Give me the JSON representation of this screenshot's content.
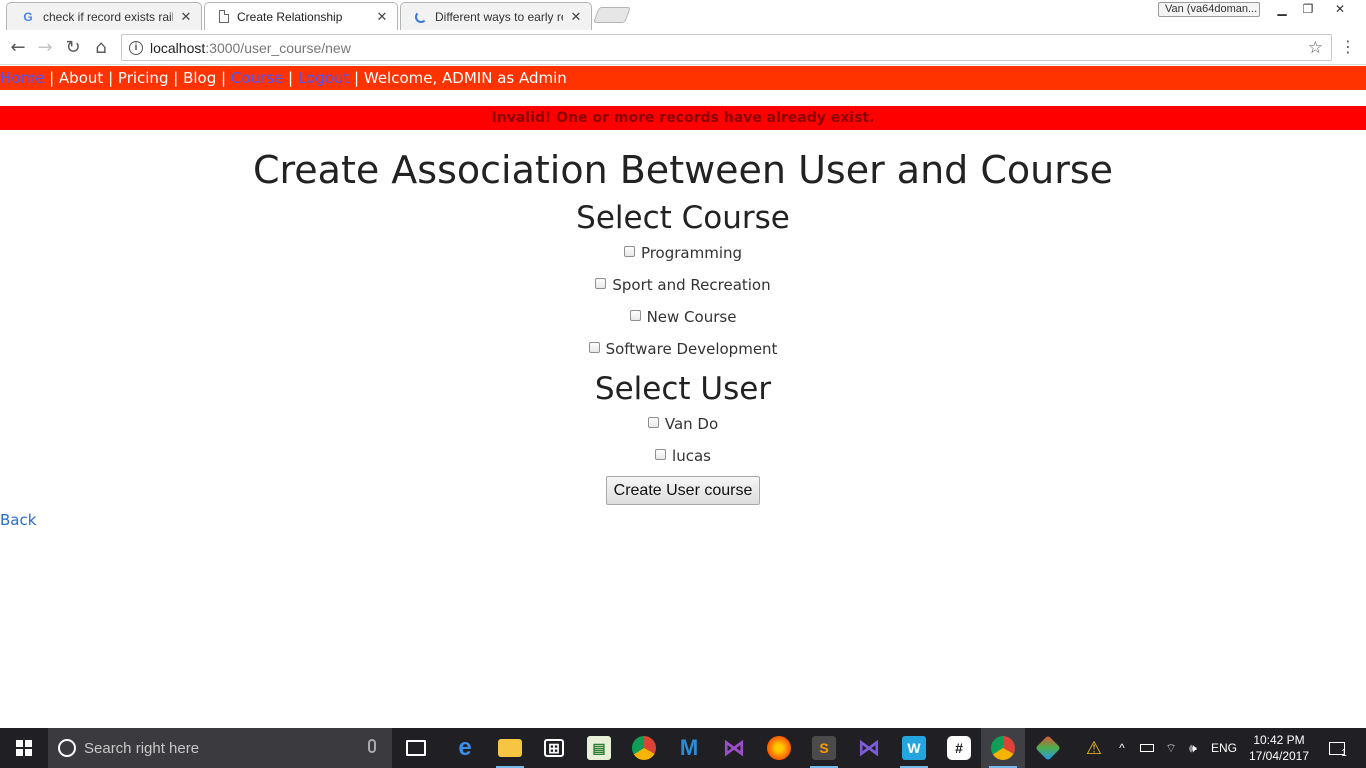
{
  "browser": {
    "tabs": [
      {
        "title": "check if record exists rails",
        "icon": "google-icon"
      },
      {
        "title": "Create Relationship",
        "icon": "page-icon"
      },
      {
        "title": "Different ways to early re",
        "icon": "loading-icon"
      }
    ],
    "profile_name": "Van (va64doman...",
    "url_host": "localhost",
    "url_path": ":3000/user_course/new"
  },
  "nav": {
    "home": "Home",
    "about": "About",
    "pricing": "Pricing",
    "blog": "Blog",
    "course": "Course",
    "logout": "Logout",
    "separator": "|",
    "welcome": "Welcome, ADMIN as Admin"
  },
  "alert": {
    "message": "Invalid! One or more records have already exist."
  },
  "form": {
    "title": "Create Association Between User and Course",
    "course_heading": "Select Course",
    "courses": [
      "Programming",
      "Sport and Recreation",
      "New Course",
      "Software Development"
    ],
    "user_heading": "Select User",
    "users": [
      "Van Do",
      "lucas"
    ],
    "submit_label": "Create User course",
    "back_label": "Back"
  },
  "taskbar": {
    "search_placeholder": "Search right here",
    "language": "ENG",
    "time": "10:42 PM",
    "date": "17/04/2017",
    "notification_count": "1"
  },
  "colors": {
    "nav_bar": "#ff3300",
    "alert_bg": "#ff0000",
    "alert_text": "#8b0000",
    "link": "#2a6ccf",
    "visited_link": "#4a55ff"
  }
}
